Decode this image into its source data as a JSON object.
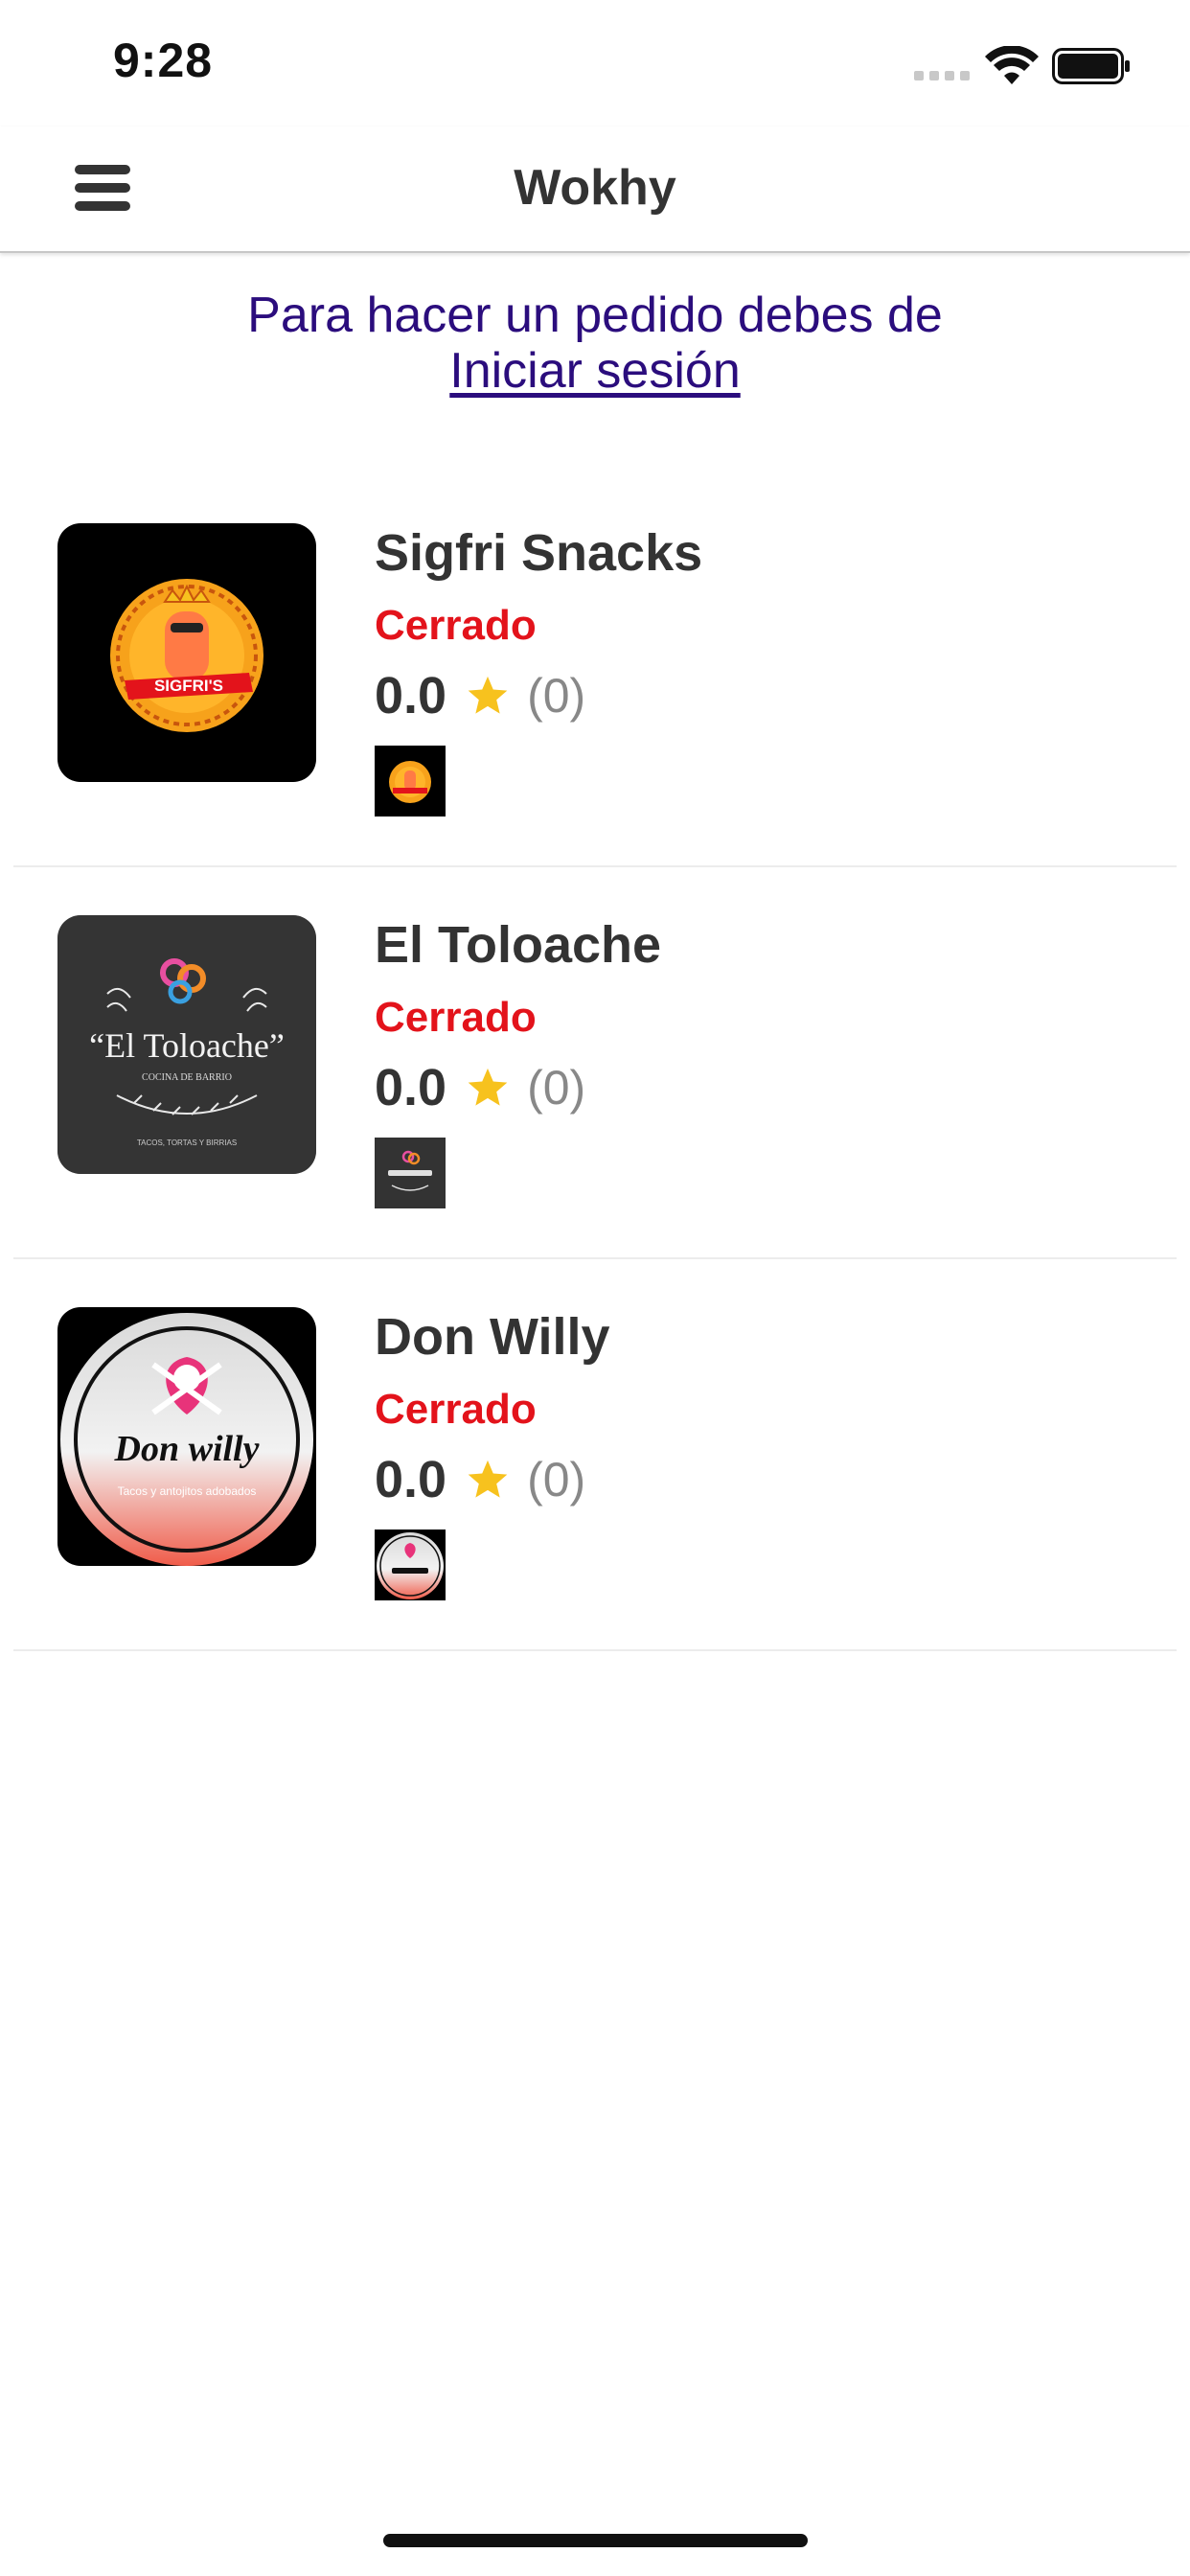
{
  "status_bar": {
    "time": "9:28",
    "icons": [
      "signal-dots-icon",
      "wifi-icon",
      "battery-icon"
    ]
  },
  "header": {
    "title": "Wokhy",
    "menu_icon": "hamburger-menu-icon"
  },
  "login_prompt": {
    "message": "Para hacer un pedido debes de",
    "link_label": " Iniciar sesión "
  },
  "restaurants": [
    {
      "name": "Sigfri Snacks",
      "status": "Cerrado",
      "rating": "0.0",
      "review_count": "(0)",
      "logo_label": "SIGFRI'S"
    },
    {
      "name": "El Toloache",
      "status": "Cerrado",
      "rating": "0.0",
      "review_count": "(0)",
      "logo_label": "“El Toloache”",
      "logo_sublabel": "COCINA DE BARRIO",
      "logo_footer": "TACOS, TORTAS Y BIRRIAS"
    },
    {
      "name": "Don Willy",
      "status": "Cerrado",
      "rating": "0.0",
      "review_count": "(0)",
      "logo_label": "Don willy",
      "logo_sublabel": "Tacos y antojitos adobados"
    }
  ],
  "colors": {
    "closed_status": "#e3131b",
    "login_text": "#2b0d7d",
    "star": "#f7c21e",
    "text_primary": "#333333",
    "text_secondary": "#888888"
  }
}
